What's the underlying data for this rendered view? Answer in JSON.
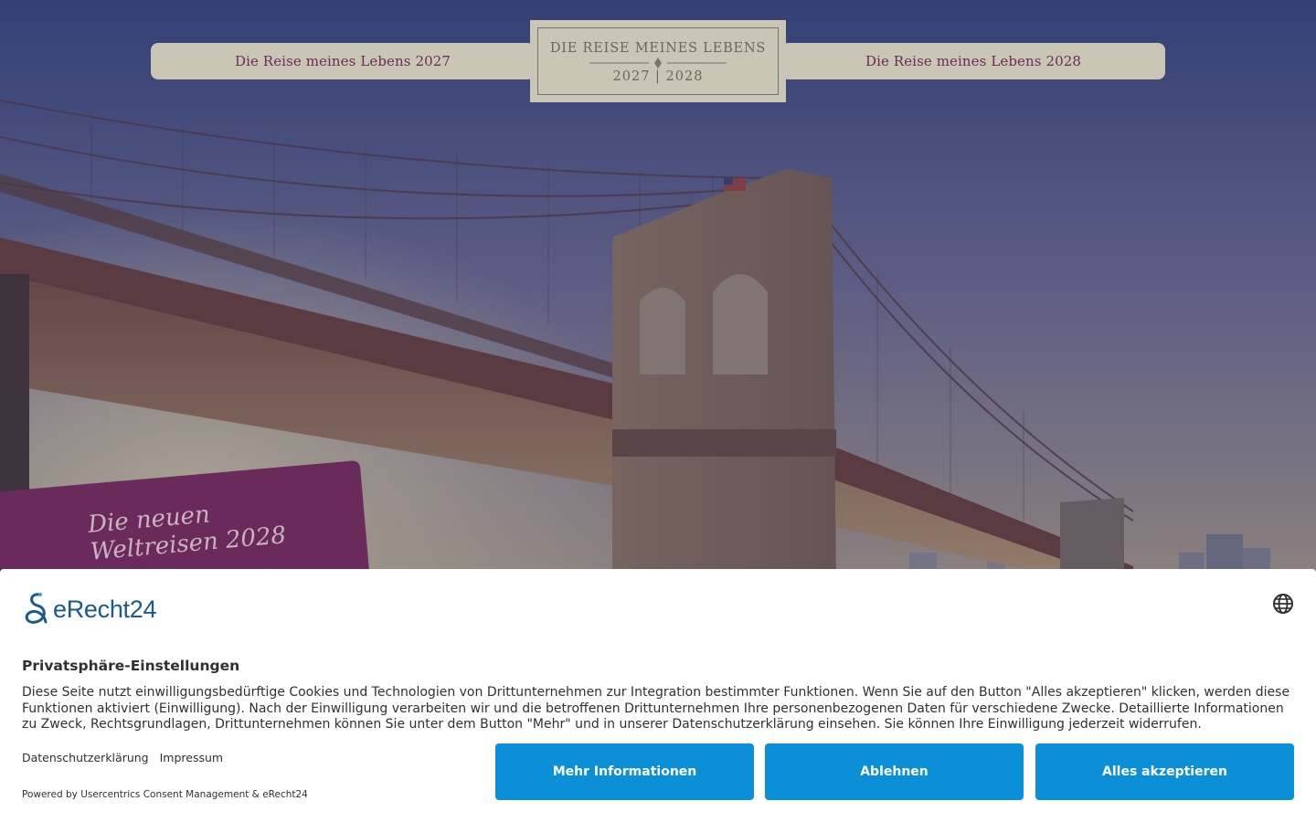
{
  "nav": {
    "left_link": "Die Reise meines Lebens 2027",
    "right_link": "Die Reise meines Lebens 2028",
    "logo_title": "DIE REISE MEINES LEBENS",
    "logo_years": "2027 | 2028"
  },
  "promo": {
    "line1": "Die neuen",
    "line2": "Weltreisen 2028"
  },
  "consent": {
    "brand_name": "eRecht24",
    "title": "Privatsphäre-Einstellungen",
    "body": "Diese Seite nutzt einwilligungsbedürftige Cookies und Technologien von Drittunternehmen zur Integration bestimmter Funktionen. Wenn Sie auf den Button \"Alles akzeptieren\" klicken, werden diese Funktionen aktiviert (Einwilligung). Nach der Einwilligung verarbeiten wir und die betroffenen Drittunternehmen Ihre personenbezogenen Daten für verschiedene Zwecke. Detaillierte Informationen zu Zweck, Rechtsgrundlagen, Drittunternehmen können Sie unter dem Button \"Mehr\" und in unserer Datenschutzerklärung einsehen. Sie können Ihre Einwilligung jederzeit widerrufen.",
    "links": {
      "privacy": "Datenschutzerklärung",
      "imprint": "Impressum"
    },
    "powered_by": "Powered by Usercentrics Consent Management & eRecht24",
    "buttons": {
      "more": "Mehr Informationen",
      "deny": "Ablehnen",
      "accept": "Alles akzeptieren"
    }
  },
  "colors": {
    "accent_button": "#0b8fd6",
    "brand_purple": "#6a2a5c",
    "nav_bg": "#c9c6b5"
  }
}
